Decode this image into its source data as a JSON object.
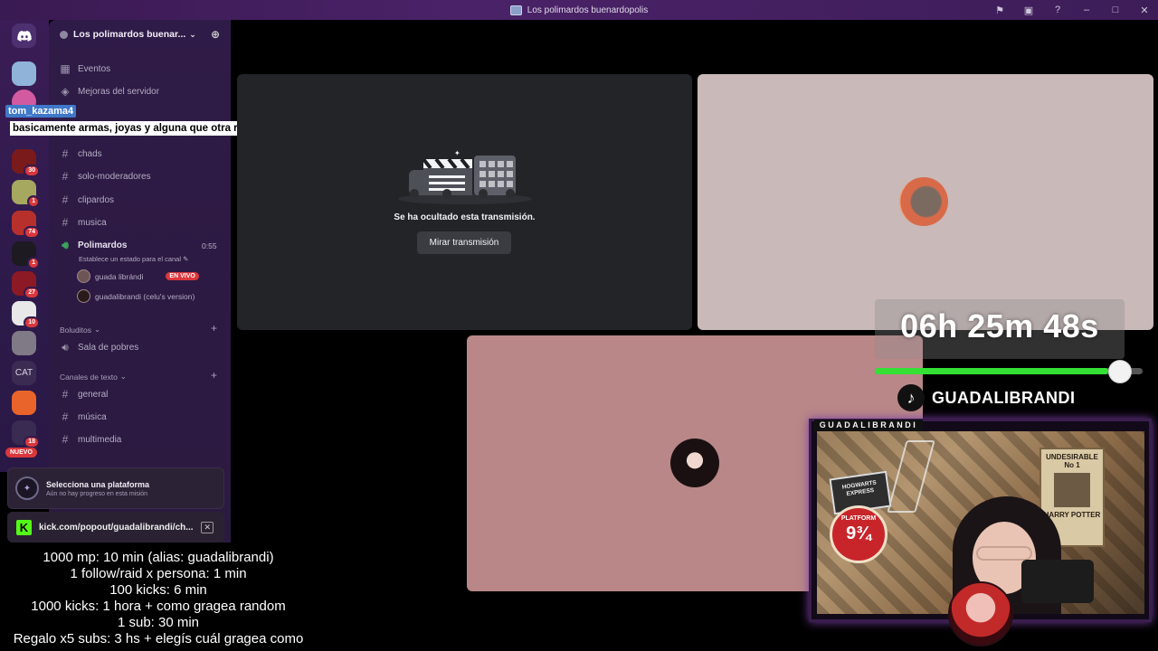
{
  "window": {
    "title": "Los polimardos buenardopolis"
  },
  "colors": {
    "accent_live": "#da373c",
    "kick_green": "#53fc18",
    "progress_green": "#35e035"
  },
  "rail": {
    "badges": [
      "30",
      "1",
      "74",
      "1",
      "27",
      "10",
      "18"
    ],
    "cat_label": "CAT",
    "new_label": "NUEVO"
  },
  "sidebar": {
    "server_name": "Los polimardos buenar...",
    "top_items": [
      {
        "icon": "calendar-icon",
        "label": "Eventos"
      },
      {
        "icon": "boost-icon",
        "label": "Mejoras del servidor"
      }
    ],
    "channels": [
      {
        "label": "chads"
      },
      {
        "label": "solo-moderadores"
      },
      {
        "label": "clipardos"
      },
      {
        "label": "musica"
      }
    ],
    "voice": {
      "name": "Polimardos",
      "time": "0:55",
      "status_hint": "Establece un estado para el canal",
      "users": [
        {
          "name": "guada librándi",
          "live": "EN VIVO"
        },
        {
          "name": "guadalibrandi (celu's version)"
        }
      ]
    },
    "category_boluditos": "Boluditos",
    "voice2": "Sala de pobres",
    "category_text": "Canales de texto",
    "text_channels": [
      "general",
      "música",
      "multimedia"
    ]
  },
  "overlay_chat": {
    "user": "tom_kazama4",
    "message": "basicamente armas, joyas y alguna que otra ropa con encantamiento"
  },
  "quest": {
    "title": "Selecciona una plataforma",
    "subtitle": "Aún no hay progreso en esta misión"
  },
  "kick_popout": {
    "url": "kick.com/popout/guadalibrandi/ch..."
  },
  "goals": [
    "1000 mp: 10 min (alias: guadalibrandi)",
    "1 follow/raid x persona: 1 min",
    "100 kicks: 6 min",
    "1000 kicks: 1 hora + como gragea random",
    "1 sub: 30 min",
    "Regalo x5 subs: 3 hs + elegís cuál gragea como"
  ],
  "stream_hidden": {
    "text": "Se ha ocultado esta transmisión.",
    "button": "Mirar transmisión"
  },
  "timer": {
    "text": "06h 25m 48s",
    "progress": 0.87
  },
  "tiktok": {
    "handle": "GUADALIBRANDI"
  },
  "webcam": {
    "label": "GUADALIBRANDI",
    "poster_top": "UNDESIRABLE",
    "poster_no": "No 1",
    "poster_name": "HARRY POTTER",
    "sign": "HOGWARTS EXPRESS",
    "platform_label": "PLATFORM",
    "platform_number": "9¾"
  }
}
